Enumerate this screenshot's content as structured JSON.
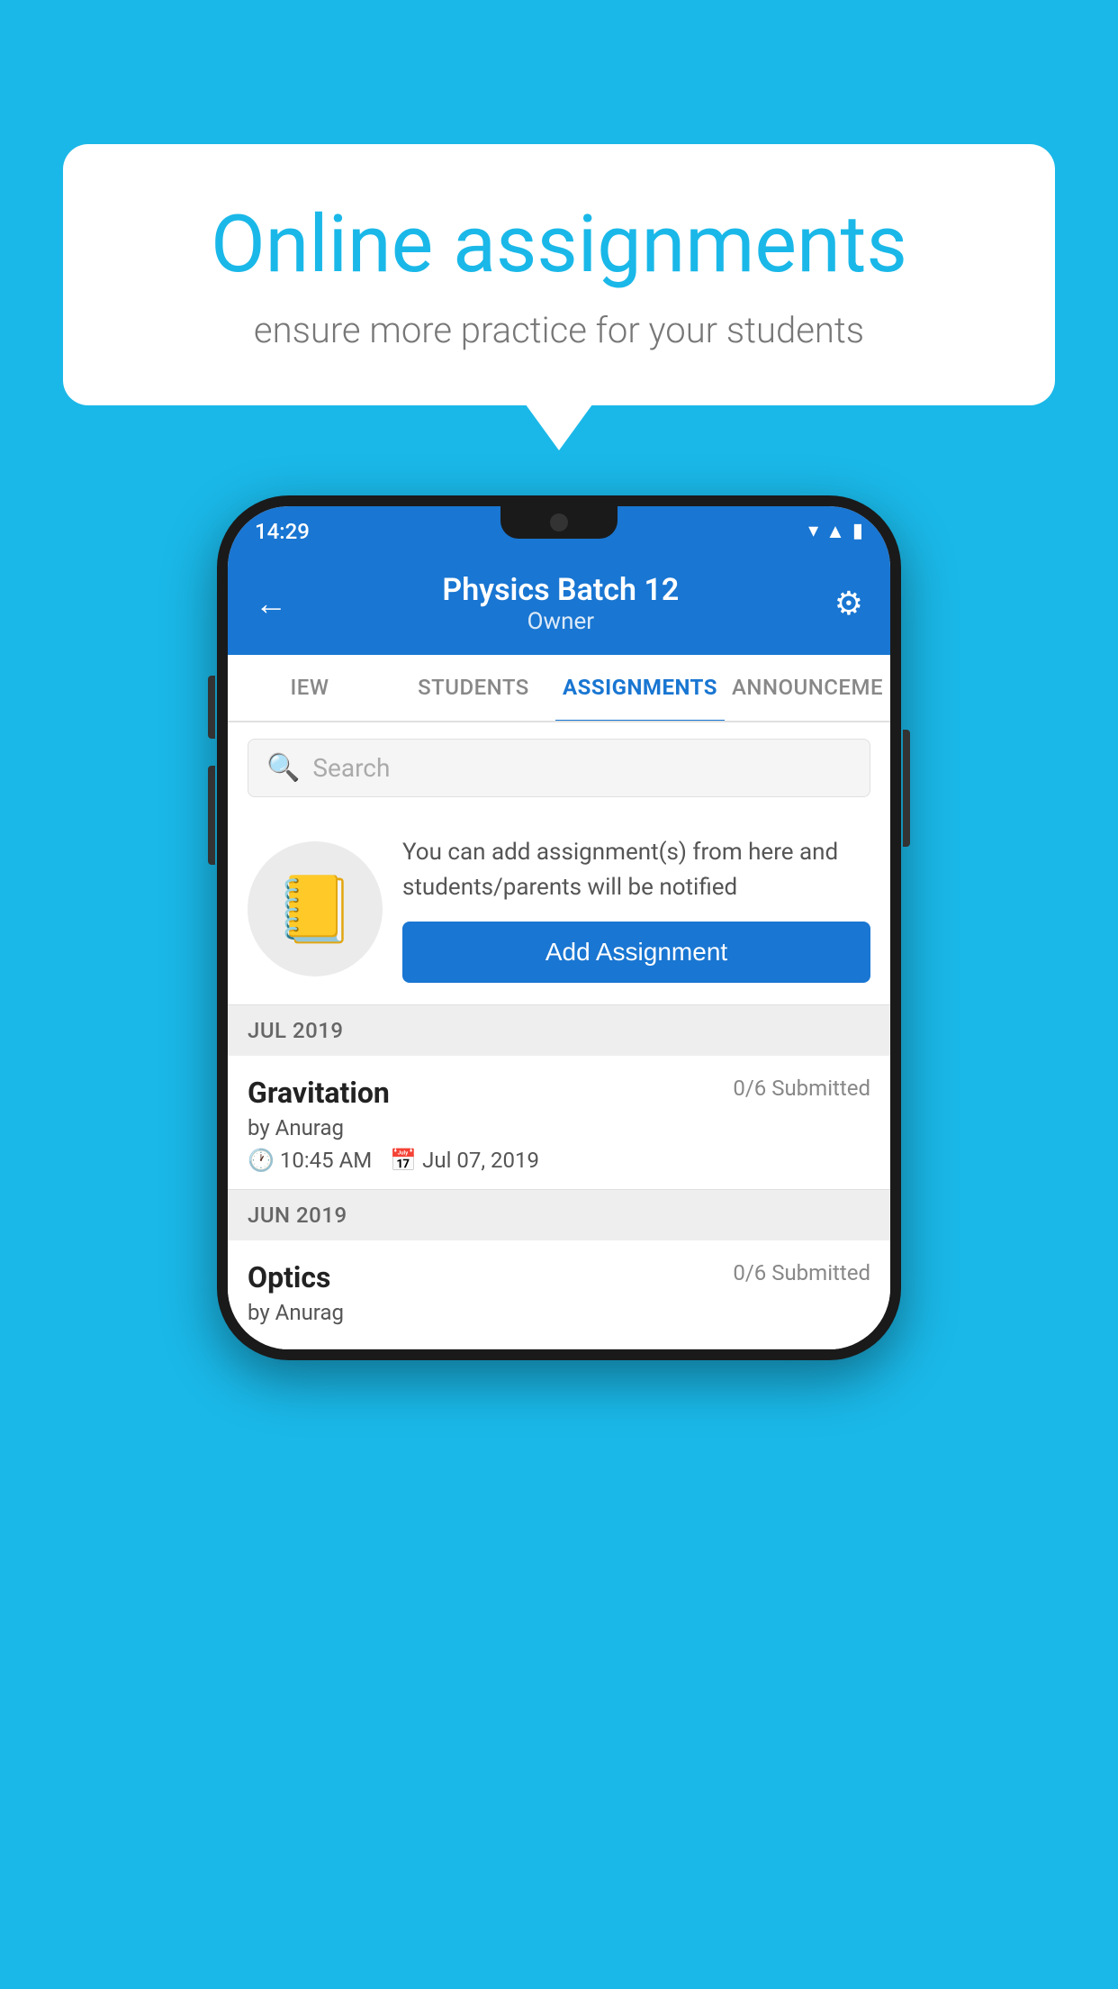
{
  "background_color": "#1ab8e8",
  "speech_bubble": {
    "title": "Online assignments",
    "subtitle": "ensure more practice for your students"
  },
  "phone": {
    "status_bar": {
      "time": "14:29",
      "wifi_icon": "wifi",
      "signal_icon": "signal",
      "battery_icon": "battery"
    },
    "header": {
      "title": "Physics Batch 12",
      "subtitle": "Owner",
      "back_icon": "←",
      "settings_icon": "⚙"
    },
    "tabs": [
      {
        "label": "IEW",
        "active": false
      },
      {
        "label": "STUDENTS",
        "active": false
      },
      {
        "label": "ASSIGNMENTS",
        "active": true
      },
      {
        "label": "ANNOUNCEME",
        "active": false
      }
    ],
    "search": {
      "placeholder": "Search"
    },
    "promo": {
      "icon": "📓",
      "text": "You can add assignment(s) from here and students/parents will be notified",
      "button_label": "Add Assignment"
    },
    "sections": [
      {
        "month_label": "JUL 2019",
        "assignments": [
          {
            "title": "Gravitation",
            "submitted": "0/6 Submitted",
            "by": "by Anurag",
            "time": "10:45 AM",
            "date": "Jul 07, 2019"
          }
        ]
      },
      {
        "month_label": "JUN 2019",
        "assignments": [
          {
            "title": "Optics",
            "submitted": "0/6 Submitted",
            "by": "by Anurag",
            "time": "",
            "date": ""
          }
        ]
      }
    ]
  }
}
